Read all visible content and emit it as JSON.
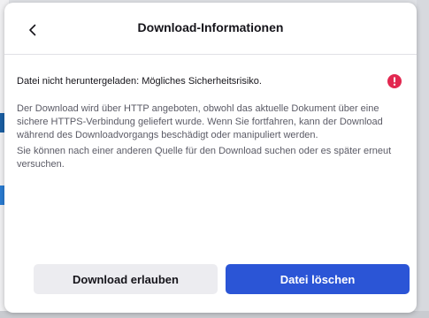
{
  "panel": {
    "title": "Download-Informationen",
    "back_icon": "chevron-left-icon"
  },
  "warning": {
    "text": "Datei nicht heruntergeladen: Mögliches Sicherheitsrisiko.",
    "icon": "error-icon",
    "icon_color": "#e22850"
  },
  "description": {
    "paragraph1": "Der Download wird über HTTP angeboten, obwohl das aktuelle Dokument über eine sichere HTTPS-Verbindung geliefert wurde. Wenn Sie fortfahren, kann der Download während des Downloadvorgangs beschädigt oder manipuliert werden.",
    "paragraph2": "Sie können nach einer anderen Quelle für den Download suchen oder es später erneut versuchen."
  },
  "buttons": {
    "allow_label": "Download erlauben",
    "delete_label": "Datei löschen",
    "primary_color": "#2b55d6"
  }
}
